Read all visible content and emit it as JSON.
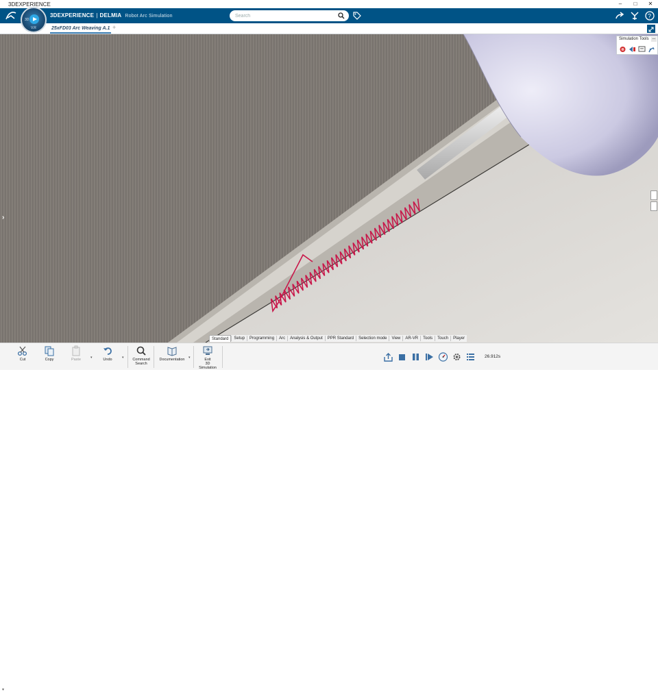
{
  "window": {
    "title": "3DEXPERIENCE",
    "controls": [
      "–",
      "□",
      "✕"
    ]
  },
  "header": {
    "brand_strong": "3DEXPERIENCE",
    "brand_separator": "|",
    "brand_product": "DELMIA",
    "app_name": "Robot Arc Simulation",
    "compass_labels": [
      "3D",
      "V.R"
    ],
    "search": {
      "placeholder": "Search",
      "value": ""
    },
    "icons": [
      "share-icon",
      "collaborate-icon",
      "help-icon"
    ],
    "bar_color": "#005386"
  },
  "tabs": [
    {
      "label": "25xFD03 Arc Weaving A.1",
      "active": true
    }
  ],
  "tab_add_label": "+",
  "simulation_tools": {
    "title": "Simulation Tools",
    "more_label": "...",
    "icons": [
      "simulation-record-icon",
      "simulation-step-icon",
      "simulation-screen-icon",
      "simulation-robot-icon"
    ]
  },
  "section_tabs": [
    {
      "label": "Standard",
      "active": true
    },
    {
      "label": "Setup"
    },
    {
      "label": "Programming"
    },
    {
      "label": "Arc"
    },
    {
      "label": "Analysis & Output"
    },
    {
      "label": "PPR Standard"
    },
    {
      "label": "Selection mode"
    },
    {
      "label": "View"
    },
    {
      "label": "AR-VR"
    },
    {
      "label": "Tools"
    },
    {
      "label": "Touch"
    },
    {
      "label": "Player"
    }
  ],
  "action_bar": {
    "cut": "Cut",
    "copy": "Copy",
    "paste": "Paste",
    "undo": "Undo",
    "command_search": "Command\nSearch",
    "command_search_1": "Command",
    "command_search_2": "Search",
    "documentation": "Documentation",
    "exit_1": "Exit",
    "exit_2": "3D Simulation"
  },
  "player": {
    "time": "26.912s",
    "buttons": [
      "export-icon",
      "stop-icon",
      "pause-icon",
      "play-step-icon",
      "speed-icon",
      "settings-icon",
      "list-icon"
    ]
  },
  "colors": {
    "weave_path": "#c8174a",
    "steel_plate": "#7a746f",
    "light_plate": "#d6d4d0",
    "torch": "#cfcde8"
  }
}
